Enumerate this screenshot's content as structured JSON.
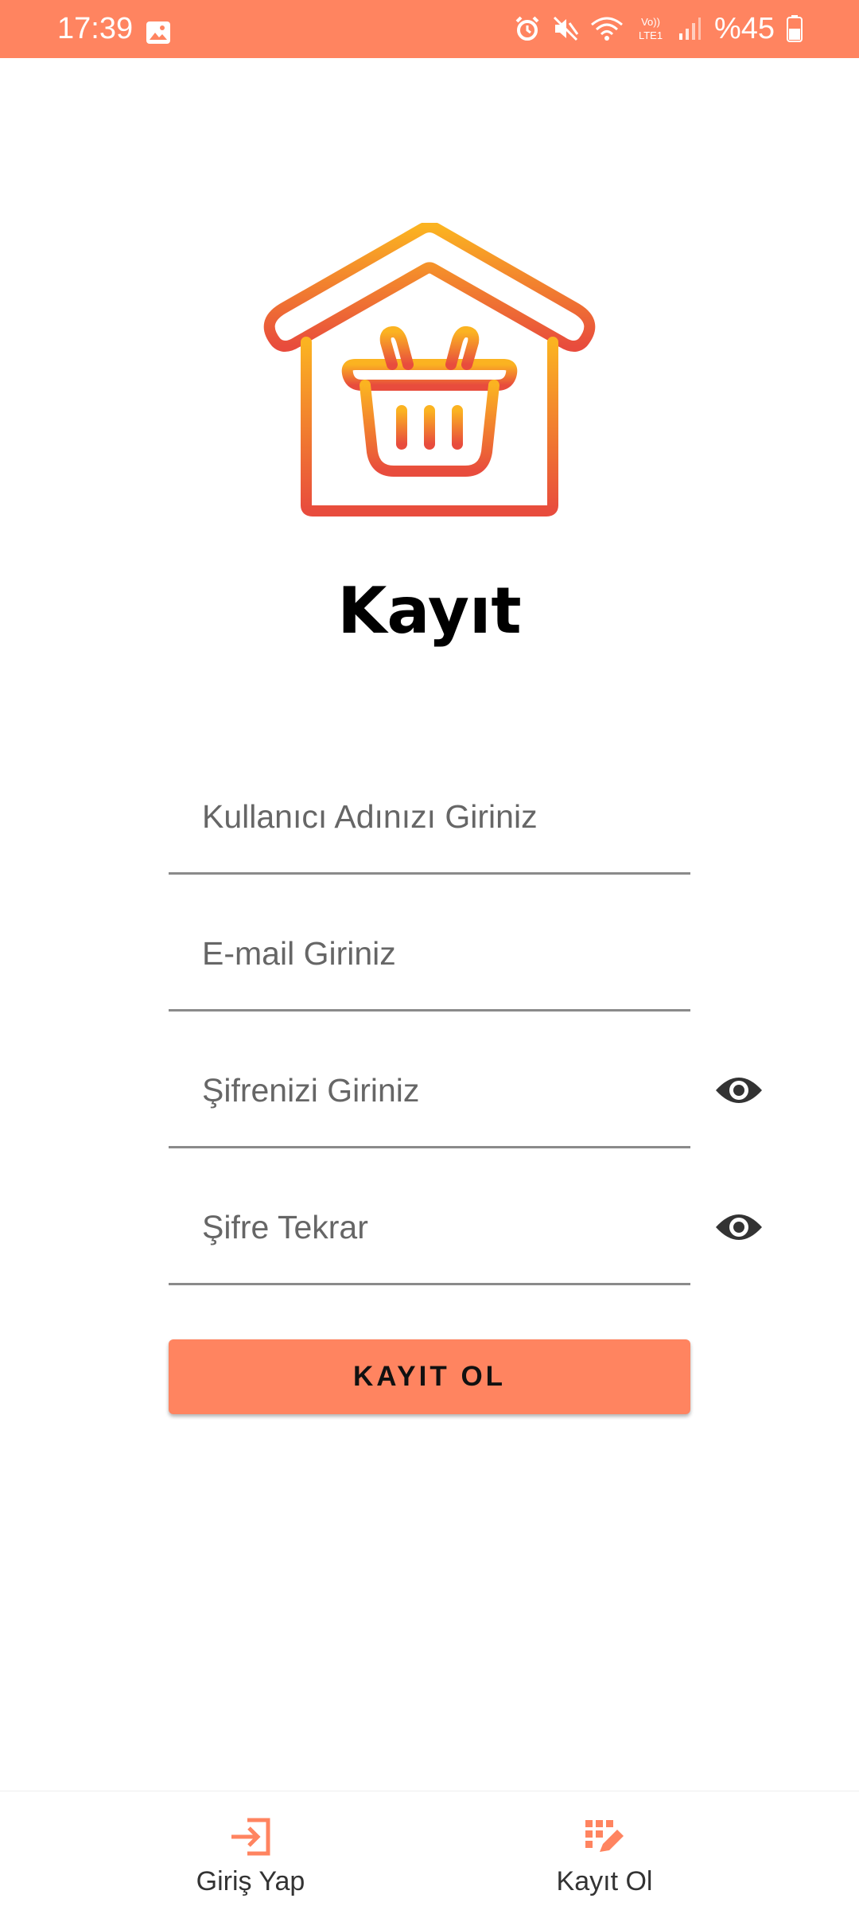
{
  "status_bar": {
    "time": "17:39",
    "battery": "%45",
    "network": "VoLTE1",
    "icons": [
      "image-icon",
      "alarm-icon",
      "mute-icon",
      "wifi-icon",
      "volte-icon",
      "signal-icon",
      "battery-icon"
    ]
  },
  "colors": {
    "accent": "#ff8460",
    "logo_gradient_top": "#fbb321",
    "logo_gradient_bottom": "#e84c3d"
  },
  "logo": {
    "icon": "house-basket-icon"
  },
  "page": {
    "title": "Kayıt"
  },
  "form": {
    "username": {
      "placeholder": "Kullanıcı Adınızı Giriniz",
      "value": ""
    },
    "email": {
      "placeholder": "E-mail Giriniz",
      "value": ""
    },
    "password": {
      "placeholder": "Şifrenizi Giriniz",
      "value": "",
      "toggle_icon": "eye-icon"
    },
    "password_repeat": {
      "placeholder": "Şifre Tekrar",
      "value": "",
      "toggle_icon": "eye-icon"
    },
    "submit_label": "KAYIT OL"
  },
  "bottom_nav": {
    "items": [
      {
        "label": "Giriş Yap",
        "icon": "login-icon"
      },
      {
        "label": "Kayıt Ol",
        "icon": "register-icon"
      }
    ]
  }
}
